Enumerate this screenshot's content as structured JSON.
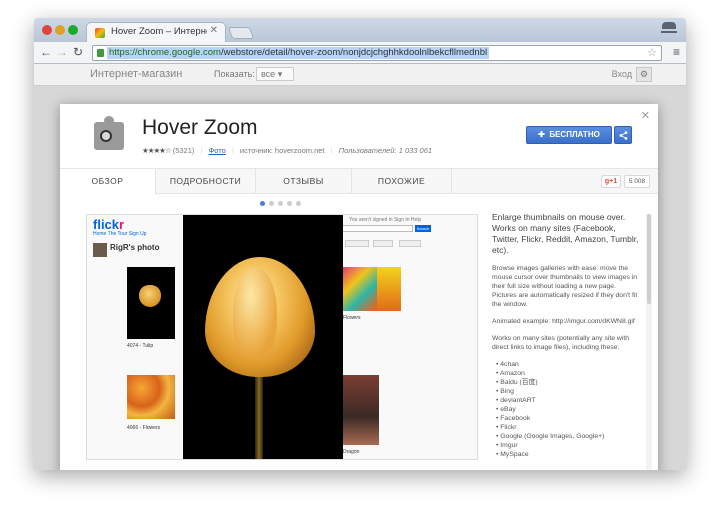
{
  "browser": {
    "tab_title": "Hover Zoom – Интернет-",
    "url_domain": "https://chrome.google.com",
    "url_path": "/webstore/detail/hover-zoom/nonjdcjchghhkdoolnlbekcfllmednbl"
  },
  "store": {
    "title": "Интернет-магазин",
    "show_label": "Показать:",
    "show_value": "все",
    "login": "Вход"
  },
  "extension": {
    "name": "Hover Zoom",
    "stars": "★★★★☆",
    "rating_count": "(5321)",
    "photo_link": "Фото",
    "source": "источник: hoverzoom.net",
    "users": "Пользователей: 1 033 061",
    "install_label": "БЕСПЛАТНО",
    "gplus_label": "g+1",
    "gplus_count": "5 008"
  },
  "tabs": [
    {
      "label": "ОБЗОР"
    },
    {
      "label": "ПОДРОБНОСТИ"
    },
    {
      "label": "ОТЗЫВЫ"
    },
    {
      "label": "ПОХОЖИЕ"
    }
  ],
  "screenshot": {
    "logo": "flickr",
    "nav": "Home   The Tour   Sign Up",
    "user_name": "RigR's photo",
    "cap1": "4074 - Tulip",
    "cap2": "4066 - Flowers",
    "right_top": "You aren't signed in   Sign In   Help",
    "search_btn": "Search",
    "cap3": "Flowers",
    "cap4": "Dragon"
  },
  "description": {
    "lead": "Enlarge thumbnails on mouse over. Works on many sites (Facebook, Twitter, Flickr, Reddit, Amazon, Tumblr, etc).",
    "p1": "Browse images galleries with ease: move the mouse cursor over thumbnails to view images in their full size without loading a new page. Pictures are automatically resized if they don't fit the window.",
    "p2": "Animated example: http://imgur.com/dKWN8.gif",
    "p3": "Works on many sites (potentially any site with direct links to image files), including these:",
    "sites": [
      "• 4chan",
      "• Amazon",
      "• Baidu (百度)",
      "• Bing",
      "• deviantART",
      "• eBay",
      "• Facebook",
      "• Flickr",
      "• Google (Google Images, Google+)",
      "• Imgur",
      "• MySpace"
    ]
  }
}
